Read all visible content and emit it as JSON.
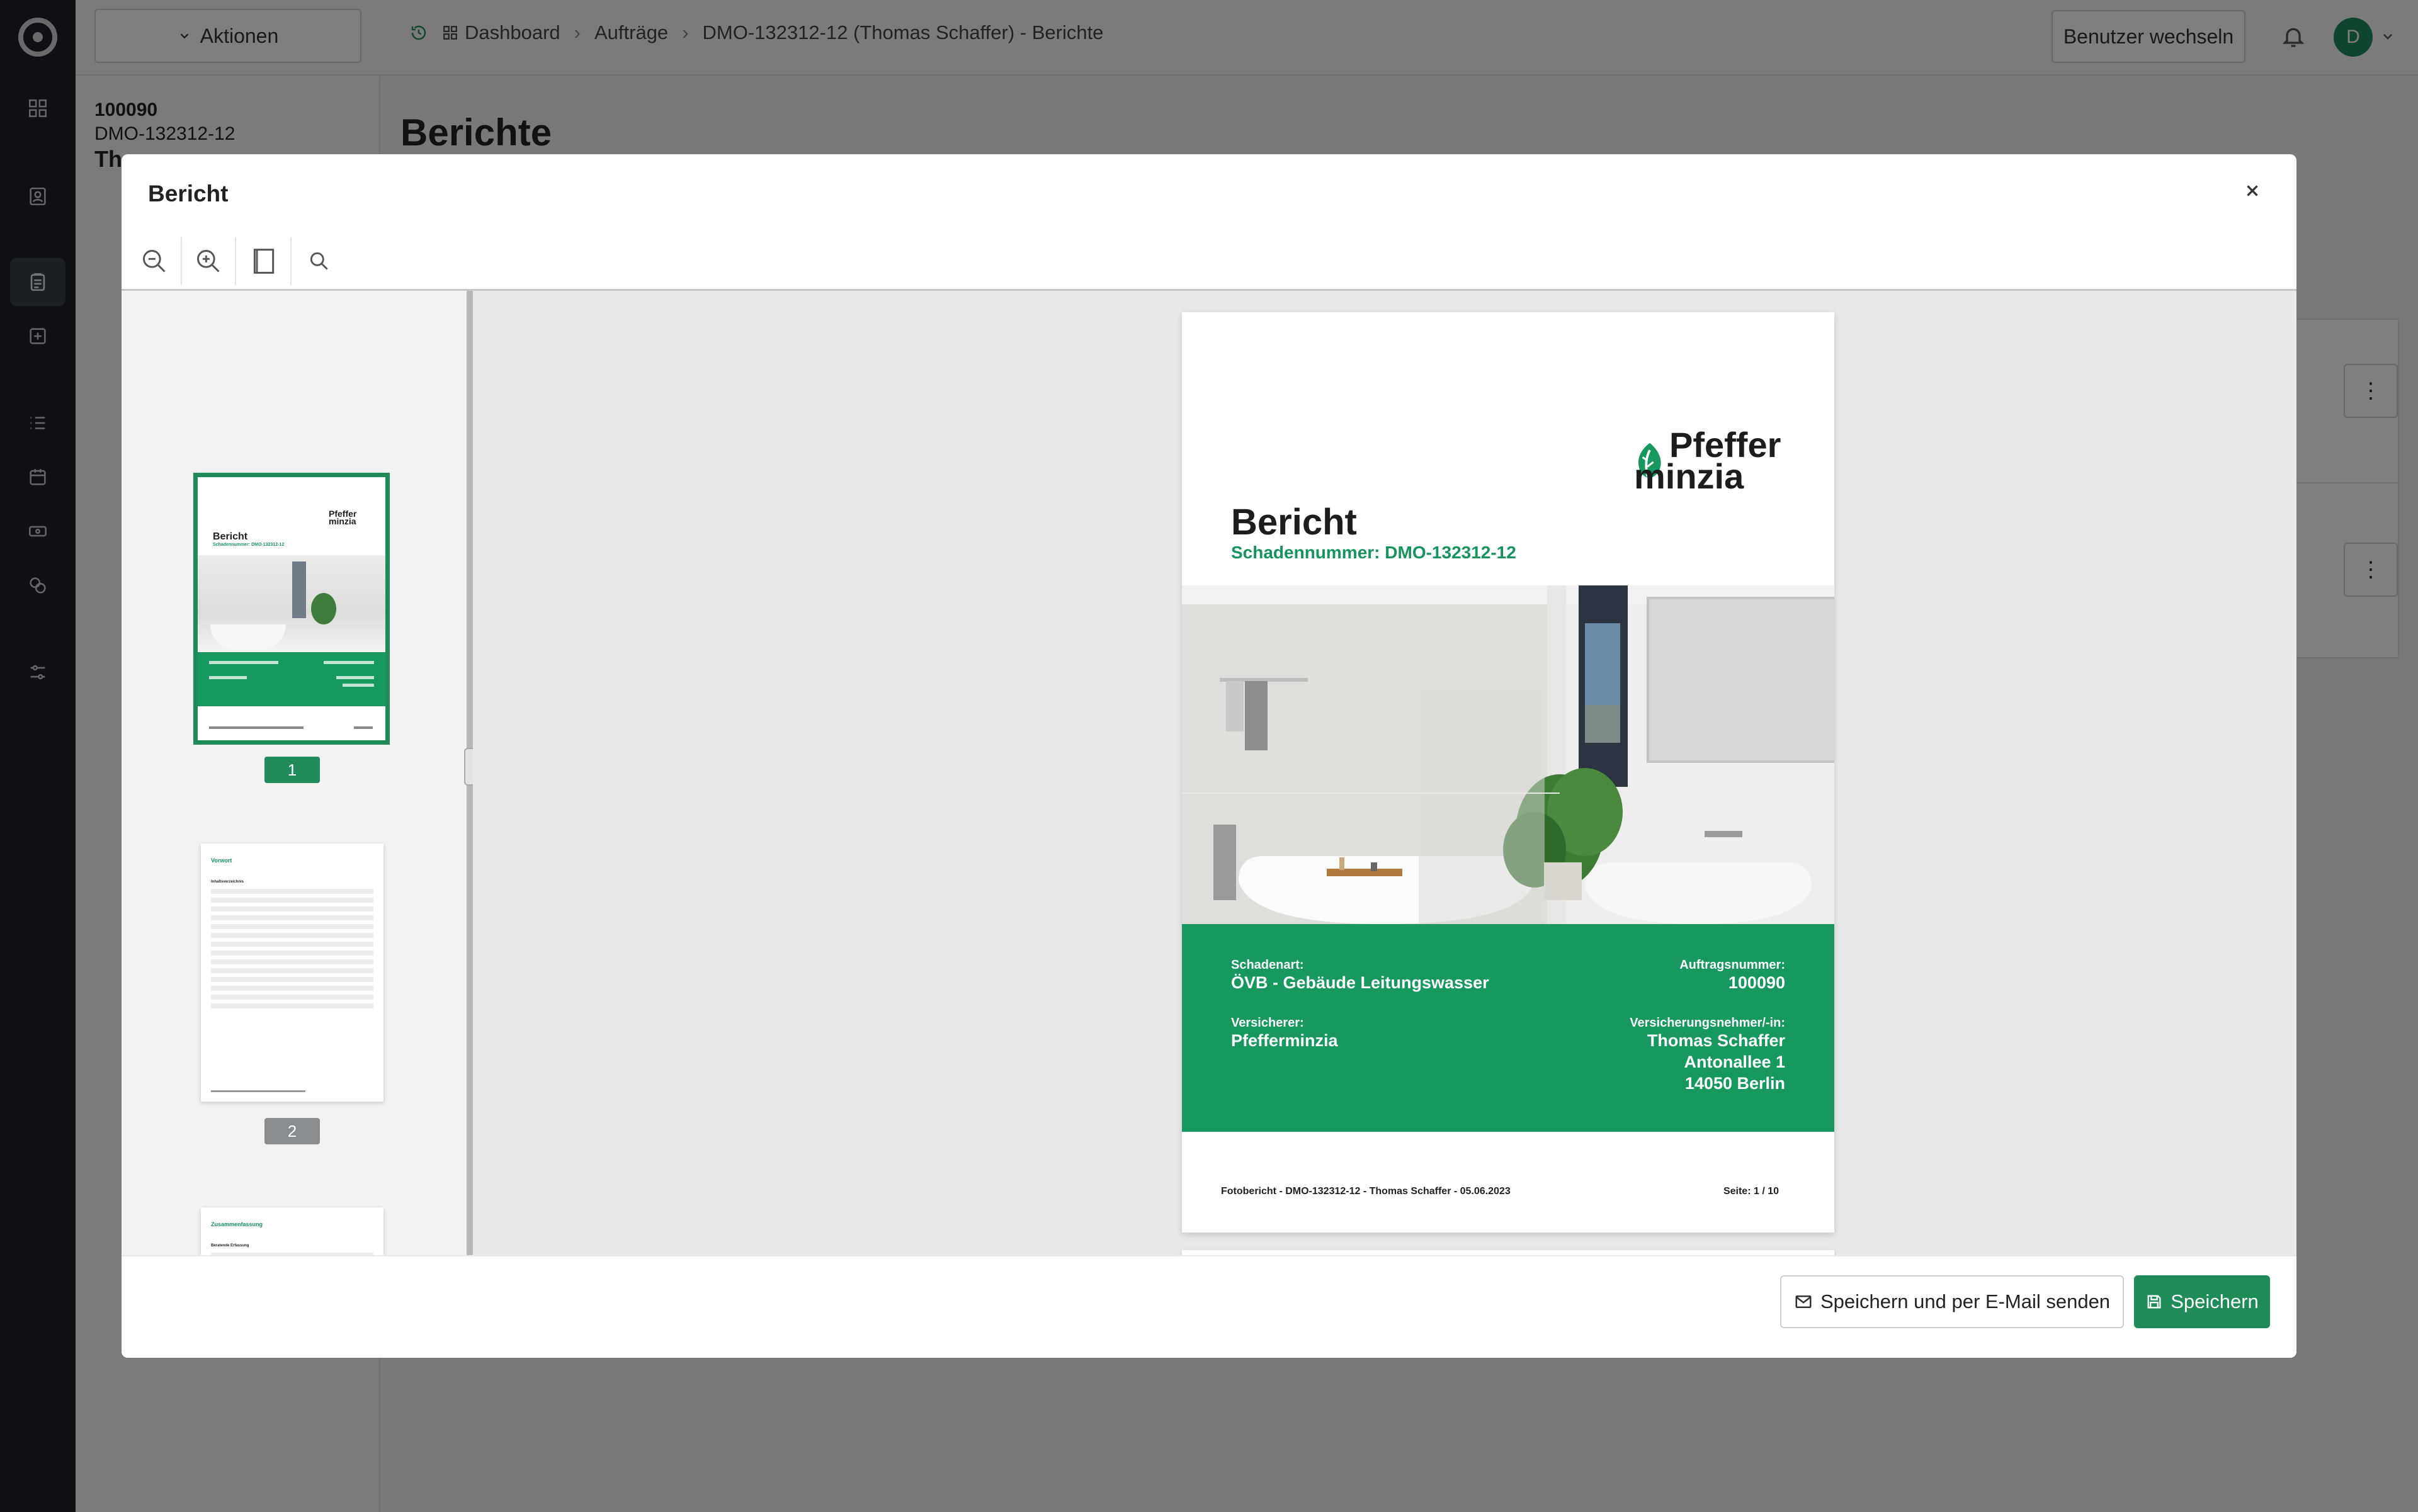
{
  "app": {
    "actions_label": "Aktionen",
    "breadcrumb": [
      "Dashboard",
      "Aufträge",
      "DMO-132312-12 (Thomas Schaffer) - Berichte"
    ],
    "switch_user_label": "Benutzer wechseln",
    "avatar_initial": "D"
  },
  "sidebar": {
    "order_number": "100090",
    "claim_number": "DMO-132312-12",
    "name_partial": "Th"
  },
  "main": {
    "title": "Berichte"
  },
  "modal": {
    "title": "Bericht",
    "toolbar": [
      "zoom-out-icon",
      "zoom-in-icon",
      "page-fit-icon",
      "search-icon"
    ],
    "thumb_pages": [
      {
        "number": "1",
        "selected": true
      },
      {
        "number": "2",
        "selected": false
      }
    ],
    "thumb2": {
      "title": "Vorwort",
      "heading": "Inhaltsverzeichnis"
    },
    "thumb3": {
      "title": "Zusammenfassung",
      "heading": "Beratende Erfassung"
    },
    "report": {
      "brand_line1": "Pfeffer",
      "brand_line2": "minzia",
      "title": "Bericht",
      "subtitle": "Schadennummer: DMO-132312-12",
      "damage_type_label": "Schadenart:",
      "damage_type": "ÖVB - Gebäude Leitungswasser",
      "order_label": "Auftragsnummer:",
      "order_number": "100090",
      "insurer_label": "Versicherer:",
      "insurer": "Pfefferminzia",
      "policyholder_label": "Versicherungsnehmer/-in:",
      "policyholder_name": "Thomas Schaffer",
      "policyholder_street": "Antonallee 1",
      "policyholder_city": "14050 Berlin",
      "footer_left": "Fotobericht - DMO-132312-12 - Thomas Schaffer - 05.06.2023",
      "footer_right": "Seite: 1 / 10"
    },
    "buttons": {
      "save_and_email": "Speichern und per E-Mail senden",
      "save": "Speichern"
    }
  },
  "colors": {
    "accent": "#1e8b58",
    "report_green": "#17985f",
    "rail": "#1c2126"
  }
}
